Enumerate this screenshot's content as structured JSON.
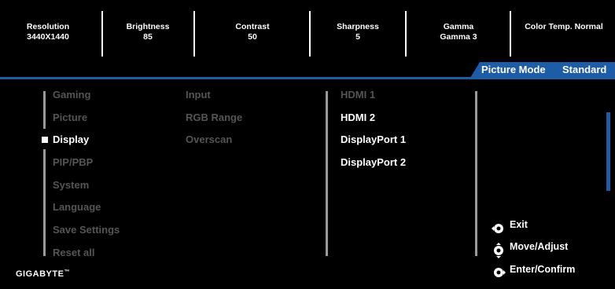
{
  "status_bar": {
    "resolution": {
      "label": "Resolution",
      "value": "3440X1440"
    },
    "brightness": {
      "label": "Brightness",
      "value": "85"
    },
    "contrast": {
      "label": "Contrast",
      "value": "50"
    },
    "sharpness": {
      "label": "Sharpness",
      "value": "5"
    },
    "gamma": {
      "label": "Gamma",
      "value": "Gamma 3"
    },
    "color_temp": {
      "label": "Color Temp. Normal"
    }
  },
  "picture_mode": {
    "label": "Picture Mode",
    "value": "Standard"
  },
  "main_menu": {
    "items": [
      "Gaming",
      "Picture",
      "Display",
      "PIP/PBP",
      "System",
      "Language",
      "Save Settings",
      "Reset all"
    ],
    "active_index": 2
  },
  "sub_menu": {
    "items": [
      "Input",
      "RGB Range",
      "Overscan"
    ]
  },
  "input_menu": {
    "items": [
      "HDMI 1",
      "HDMI 2",
      "DisplayPort 1",
      "DisplayPort 2"
    ]
  },
  "hints": {
    "exit": "Exit",
    "move_adjust": "Move/Adjust",
    "enter_confirm": "Enter/Confirm"
  },
  "brand": {
    "name": "GIGABYTE",
    "trademark": "™"
  },
  "colors": {
    "accent": "#1d5da8",
    "dim_text": "#555555",
    "active_text": "#ffffff"
  }
}
